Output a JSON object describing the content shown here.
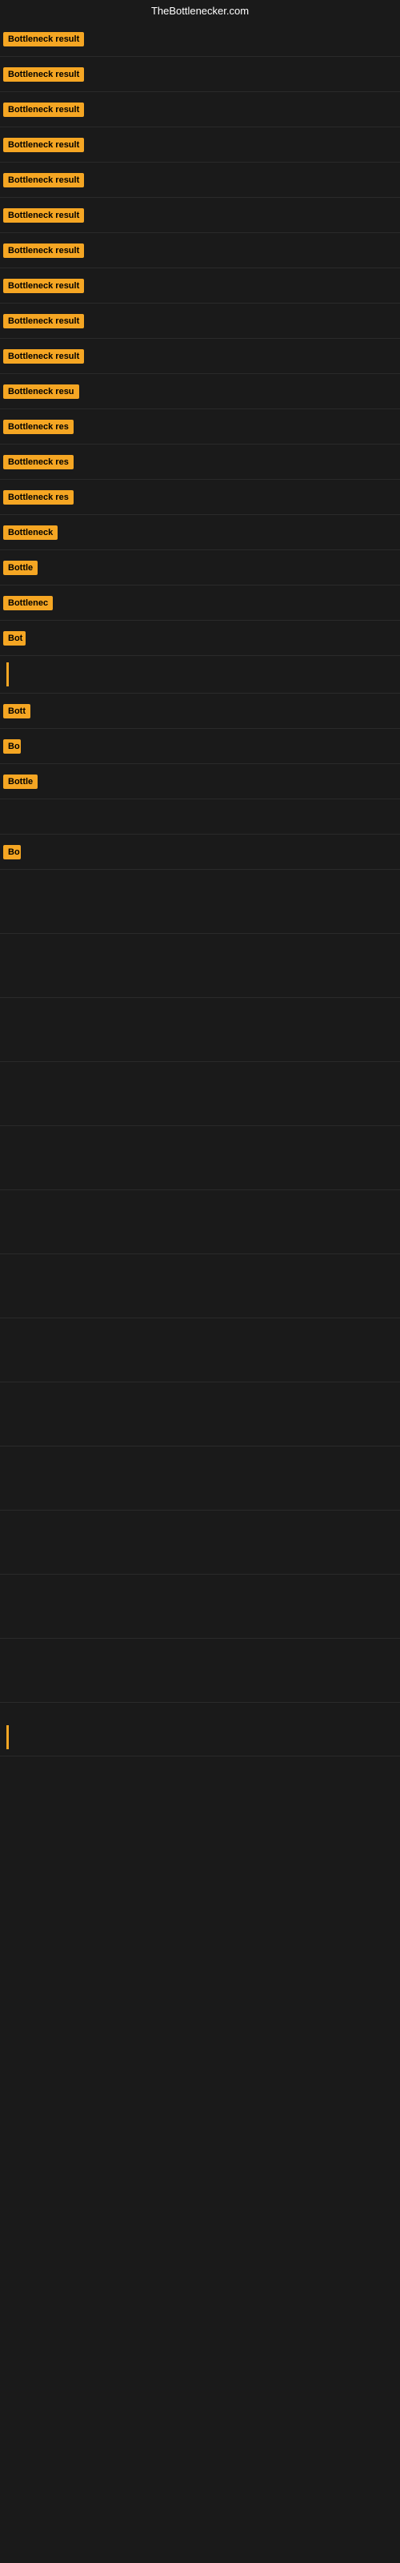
{
  "site": {
    "title": "TheBottlenecker.com"
  },
  "badges": [
    {
      "id": 1,
      "text": "Bottleneck result",
      "width": "auto",
      "visible_chars": 17
    },
    {
      "id": 2,
      "text": "Bottleneck result",
      "width": "auto",
      "visible_chars": 17
    },
    {
      "id": 3,
      "text": "Bottleneck result",
      "width": "auto",
      "visible_chars": 17
    },
    {
      "id": 4,
      "text": "Bottleneck result",
      "width": "auto",
      "visible_chars": 17
    },
    {
      "id": 5,
      "text": "Bottleneck result",
      "width": "auto",
      "visible_chars": 17
    },
    {
      "id": 6,
      "text": "Bottleneck result",
      "width": "auto",
      "visible_chars": 17
    },
    {
      "id": 7,
      "text": "Bottleneck result",
      "width": "auto",
      "visible_chars": 17
    },
    {
      "id": 8,
      "text": "Bottleneck result",
      "width": "auto",
      "visible_chars": 17
    },
    {
      "id": 9,
      "text": "Bottleneck result",
      "width": "auto",
      "visible_chars": 17
    },
    {
      "id": 10,
      "text": "Bottleneck result",
      "width": "auto",
      "visible_chars": 17
    },
    {
      "id": 11,
      "text": "Bottleneck resu",
      "width": "auto",
      "visible_chars": 15
    },
    {
      "id": 12,
      "text": "Bottleneck res",
      "width": "auto",
      "visible_chars": 14
    },
    {
      "id": 13,
      "text": "Bottleneck res",
      "width": "auto",
      "visible_chars": 14
    },
    {
      "id": 14,
      "text": "Bottleneck res",
      "width": "auto",
      "visible_chars": 14
    },
    {
      "id": 15,
      "text": "Bottleneck",
      "width": "auto",
      "visible_chars": 10
    },
    {
      "id": 16,
      "text": "Bottle",
      "width": "auto",
      "visible_chars": 6
    },
    {
      "id": 17,
      "text": "Bottlenec",
      "width": "auto",
      "visible_chars": 9
    },
    {
      "id": 18,
      "text": "Bot",
      "width": "auto",
      "visible_chars": 3
    },
    {
      "id": 19,
      "text": "",
      "width": "auto",
      "visible_chars": 0,
      "type": "line"
    },
    {
      "id": 20,
      "text": "Bott",
      "width": "auto",
      "visible_chars": 4
    },
    {
      "id": 21,
      "text": "Bo",
      "width": "auto",
      "visible_chars": 2
    },
    {
      "id": 22,
      "text": "Bottle",
      "width": "auto",
      "visible_chars": 6
    },
    {
      "id": 23,
      "text": "",
      "width": "auto",
      "visible_chars": 0
    },
    {
      "id": 24,
      "text": "Bo",
      "width": "auto",
      "visible_chars": 2
    }
  ]
}
